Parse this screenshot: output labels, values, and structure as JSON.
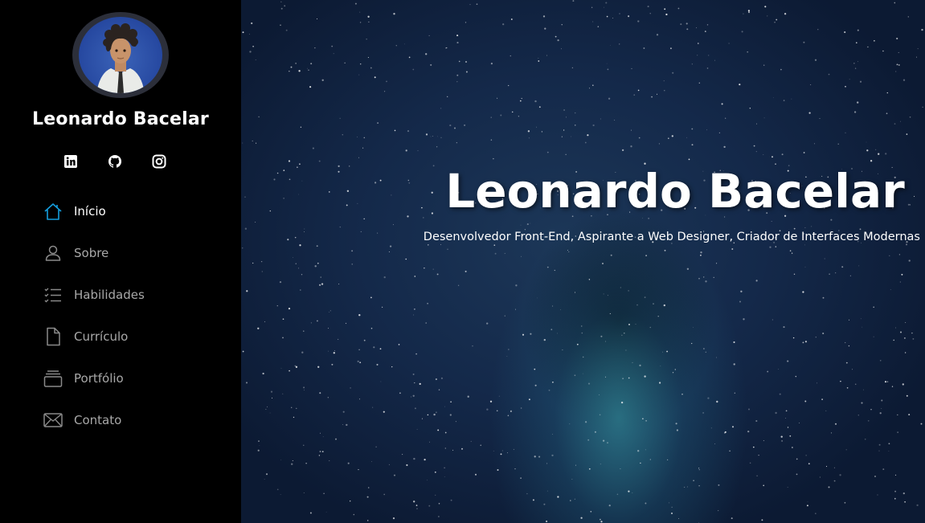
{
  "profile": {
    "name": "Leonardo Bacelar",
    "avatar": "avatar-illustration"
  },
  "social": [
    {
      "name": "linkedin",
      "icon": "linkedin-icon"
    },
    {
      "name": "github",
      "icon": "github-icon"
    },
    {
      "name": "instagram",
      "icon": "instagram-icon"
    }
  ],
  "nav": {
    "items": [
      {
        "label": "Início",
        "icon": "home-icon",
        "active": true
      },
      {
        "label": "Sobre",
        "icon": "user-icon",
        "active": false
      },
      {
        "label": "Habilidades",
        "icon": "list-check-icon",
        "active": false
      },
      {
        "label": "Currículo",
        "icon": "file-icon",
        "active": false
      },
      {
        "label": "Portfólio",
        "icon": "collection-icon",
        "active": false
      },
      {
        "label": "Contato",
        "icon": "envelope-icon",
        "active": false
      }
    ]
  },
  "hero": {
    "title": "Leonardo Bacelar",
    "subtitle": "Desenvolvedor Front-End, Aspirante a Web Designer, Criador de Interfaces Modernas"
  },
  "colors": {
    "sidebar_bg": "#000000",
    "active_icon": "#149ddd",
    "inactive_label": "#a8a8a8",
    "hero_bg": "#14294a"
  }
}
